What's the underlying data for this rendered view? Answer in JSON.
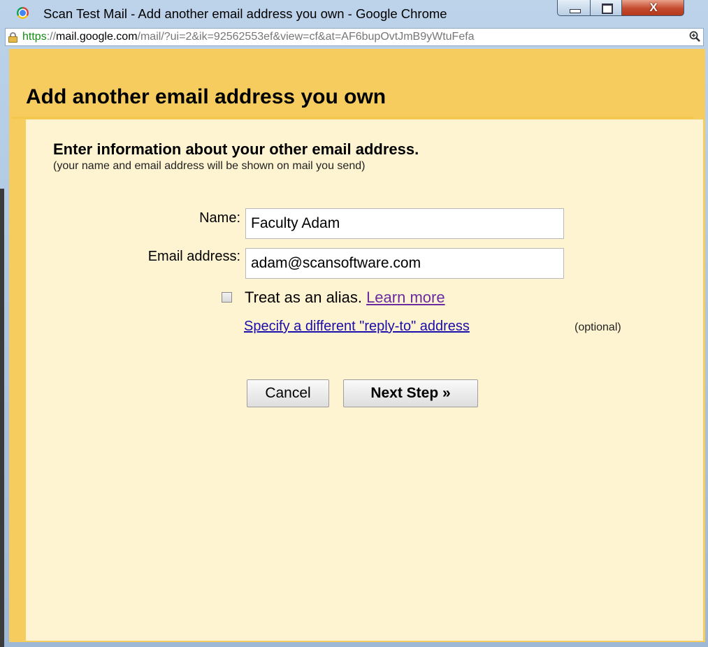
{
  "window": {
    "title": "Scan Test Mail - Add another email address you own - Google Chrome",
    "buttons": {
      "minimize": "minimize",
      "maximize": "maximize",
      "close": "X"
    }
  },
  "addressbar": {
    "scheme": "https",
    "scheme_sep": "://",
    "host": "mail.google.com",
    "path": "/mail/?ui=2&ik=92562553ef&view=cf&at=AF6bupOvtJmB9yWtuFefa"
  },
  "dialog": {
    "title": "Add another email address you own",
    "instruction_title": "Enter information about your other email address.",
    "instruction_sub": "(your name and email address will be shown on mail you send)",
    "name_label": "Name:",
    "name_value": "Faculty Adam",
    "email_label": "Email address:",
    "email_value": "adam@scansoftware.com",
    "alias_label": "Treat as an alias.",
    "learn_more": "Learn more",
    "replyto_link": "Specify a different \"reply-to\" address",
    "optional": "(optional)",
    "cancel_button": "Cancel",
    "next_button": "Next Step »"
  },
  "colors": {
    "header_bg": "#f7cc5f",
    "panel_bg": "#fff4d1",
    "divider": "#f3c64c",
    "link_visited": "#6b2ba0",
    "link": "#1a0dab"
  }
}
